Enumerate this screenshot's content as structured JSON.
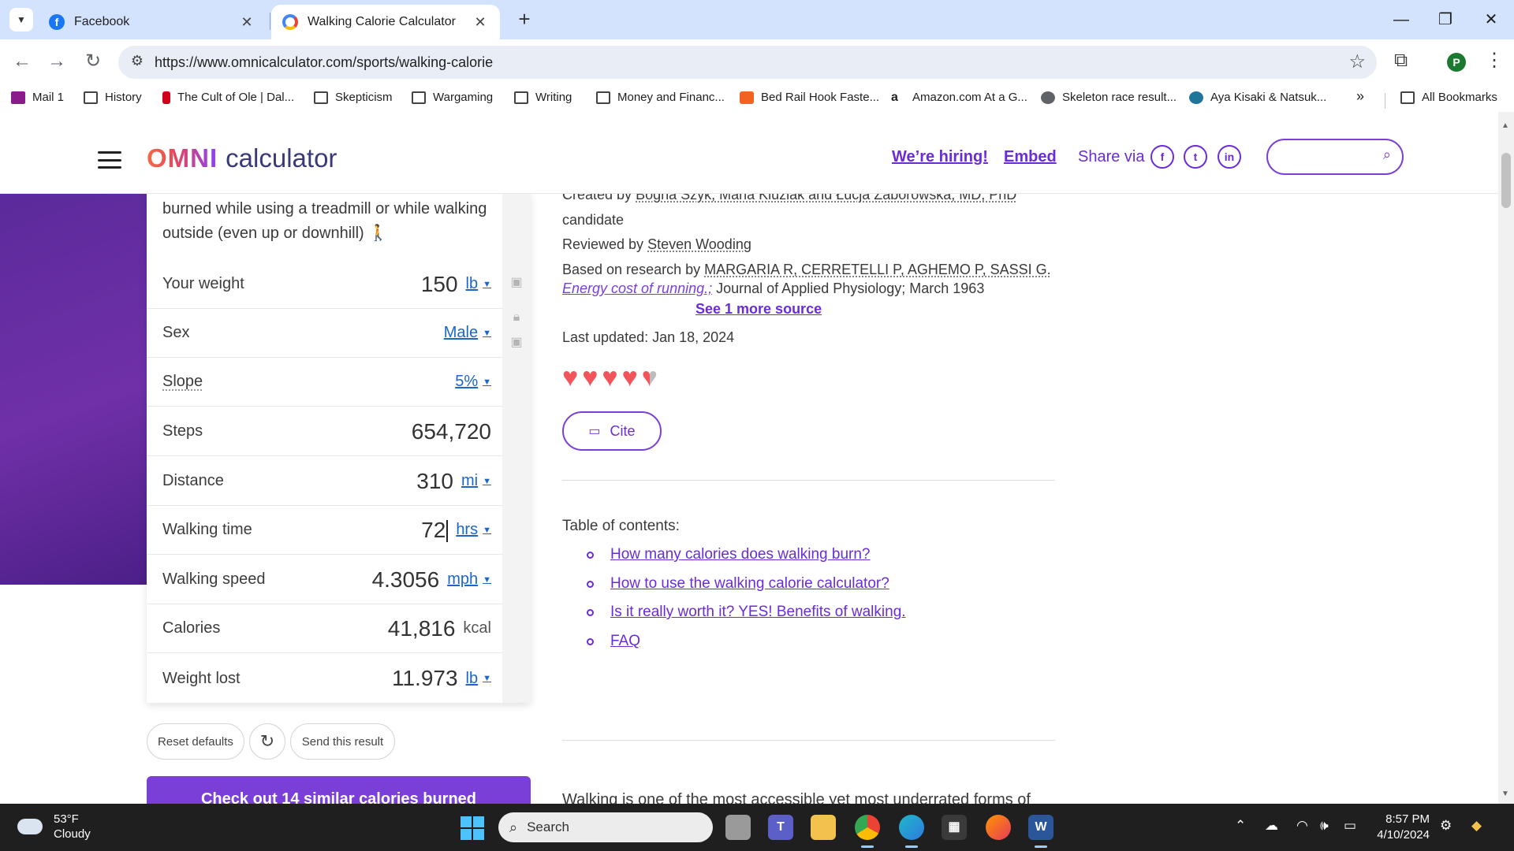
{
  "browser": {
    "tabs": [
      {
        "title": "Facebook",
        "active": false,
        "favicon_color": "#1877f2"
      },
      {
        "title": "Walking Calorie Calculator",
        "active": true,
        "favicon_color": "#4285f4"
      }
    ],
    "url": "https://www.omnicalculator.com/sports/walking-calorie",
    "profile_initial": "P",
    "bookmarks": [
      {
        "label": "Mail 1",
        "icon": "mail-icon"
      },
      {
        "label": "History",
        "icon": "folder-icon"
      },
      {
        "label": "The Cult of Ole | Dal...",
        "icon": "red-bar-icon"
      },
      {
        "label": "Skepticism",
        "icon": "folder-icon"
      },
      {
        "label": "Wargaming",
        "icon": "folder-icon"
      },
      {
        "label": "Writing",
        "icon": "folder-icon"
      },
      {
        "label": "Money and Financ...",
        "icon": "folder-icon"
      },
      {
        "label": "Bed Rail Hook Faste...",
        "icon": "orange-square-icon"
      },
      {
        "label": "Amazon.com At a G...",
        "icon": "amazon-icon"
      },
      {
        "label": "Skeleton race result...",
        "icon": "globe-icon"
      },
      {
        "label": "Aya Kisaki & Natsuk...",
        "icon": "wordpress-icon"
      }
    ],
    "overflow": "»",
    "all_bookmarks": "All Bookmarks"
  },
  "site": {
    "logo_omni": "OMNI",
    "logo_calc": "calculator",
    "hiring": "We’re hiring!",
    "embed": "Embed",
    "share_via": "Share via",
    "share_icons": [
      "f",
      "t",
      "in"
    ]
  },
  "calculator": {
    "intro": "burned while using a treadmill or while walking outside (even up or downhill) 🚶",
    "rows": [
      {
        "label": "Your weight",
        "value": "150",
        "unit": "lb"
      },
      {
        "label": "Sex",
        "value": "",
        "unit": "Male"
      },
      {
        "label": "Slope",
        "value": "",
        "unit": "5%"
      },
      {
        "label": "Steps",
        "value": "654,720",
        "unit": ""
      },
      {
        "label": "Distance",
        "value": "310",
        "unit": "mi"
      },
      {
        "label": "Walking time",
        "value": "72",
        "unit": "hrs"
      },
      {
        "label": "Walking speed",
        "value": "4.3056",
        "unit": "mph"
      },
      {
        "label": "Calories",
        "value": "41,816",
        "unit": "kcal"
      },
      {
        "label": "Weight lost",
        "value": "11.973",
        "unit": "lb"
      }
    ],
    "reset": "Reset defaults",
    "send": "Send this result",
    "similar": "Check out 14 similar calories burned"
  },
  "article": {
    "created_by": "Created by",
    "authors": "Bogna Szyk, Maria Kluziak and Łucja Zaborowska, MD, PhD",
    "authors_tail": "candidate",
    "reviewed_by": "Reviewed by",
    "reviewer": "Steven Wooding",
    "based_on": "Based on research by",
    "research_authors": "MARGARIA R, CERRETELLI P, AGHEMO P, SASSI G.",
    "research_title": "Energy cost of running.;",
    "research_journal": "Journal of Applied Physiology; March 1963",
    "see_more": "See 1 more source",
    "last_updated": "Last updated: Jan 18, 2024",
    "rating": 4.5,
    "cite": "Cite",
    "toc_title": "Table of contents:",
    "toc": [
      "How many calories does walking burn?",
      "How to use the walking calorie calculator?",
      "Is it really worth it? YES! Benefits of walking.",
      "FAQ"
    ],
    "body_start": "Walking is one of the most accessible yet most underrated forms of"
  },
  "taskbar": {
    "temp": "53°F",
    "condition": "Cloudy",
    "search": "Search",
    "time": "8:57 PM",
    "date": "4/10/2024"
  }
}
